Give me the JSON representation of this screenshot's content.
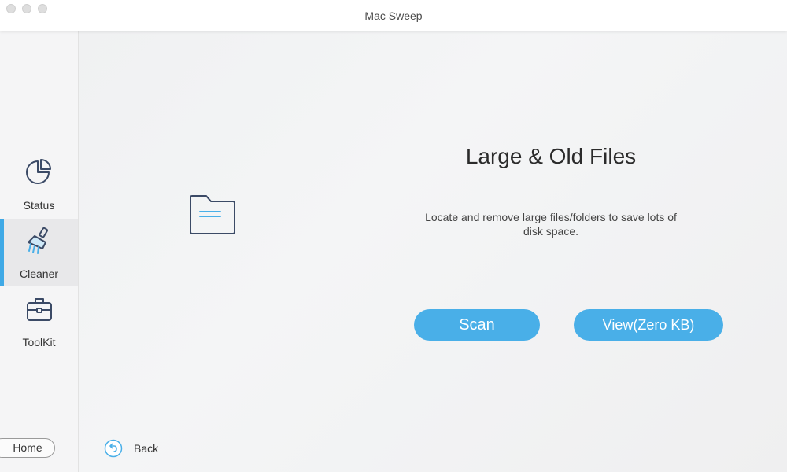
{
  "window": {
    "title": "Mac Sweep"
  },
  "sidebar": {
    "items": [
      {
        "label": "Status",
        "icon": "pie-chart-icon",
        "active": false
      },
      {
        "label": "Cleaner",
        "icon": "broom-icon",
        "active": true
      },
      {
        "label": "ToolKit",
        "icon": "toolbox-icon",
        "active": false
      }
    ],
    "home_label": "Home"
  },
  "main": {
    "title": "Large & Old Files",
    "description": "Locate and remove large files/folders to save lots of disk space.",
    "scan_label": "Scan",
    "view_label": "View(Zero KB)",
    "back_label": "Back",
    "feature_icon": "folder-icon"
  },
  "colors": {
    "accent": "#49afe8",
    "icon_stroke": "#3b4a66"
  }
}
